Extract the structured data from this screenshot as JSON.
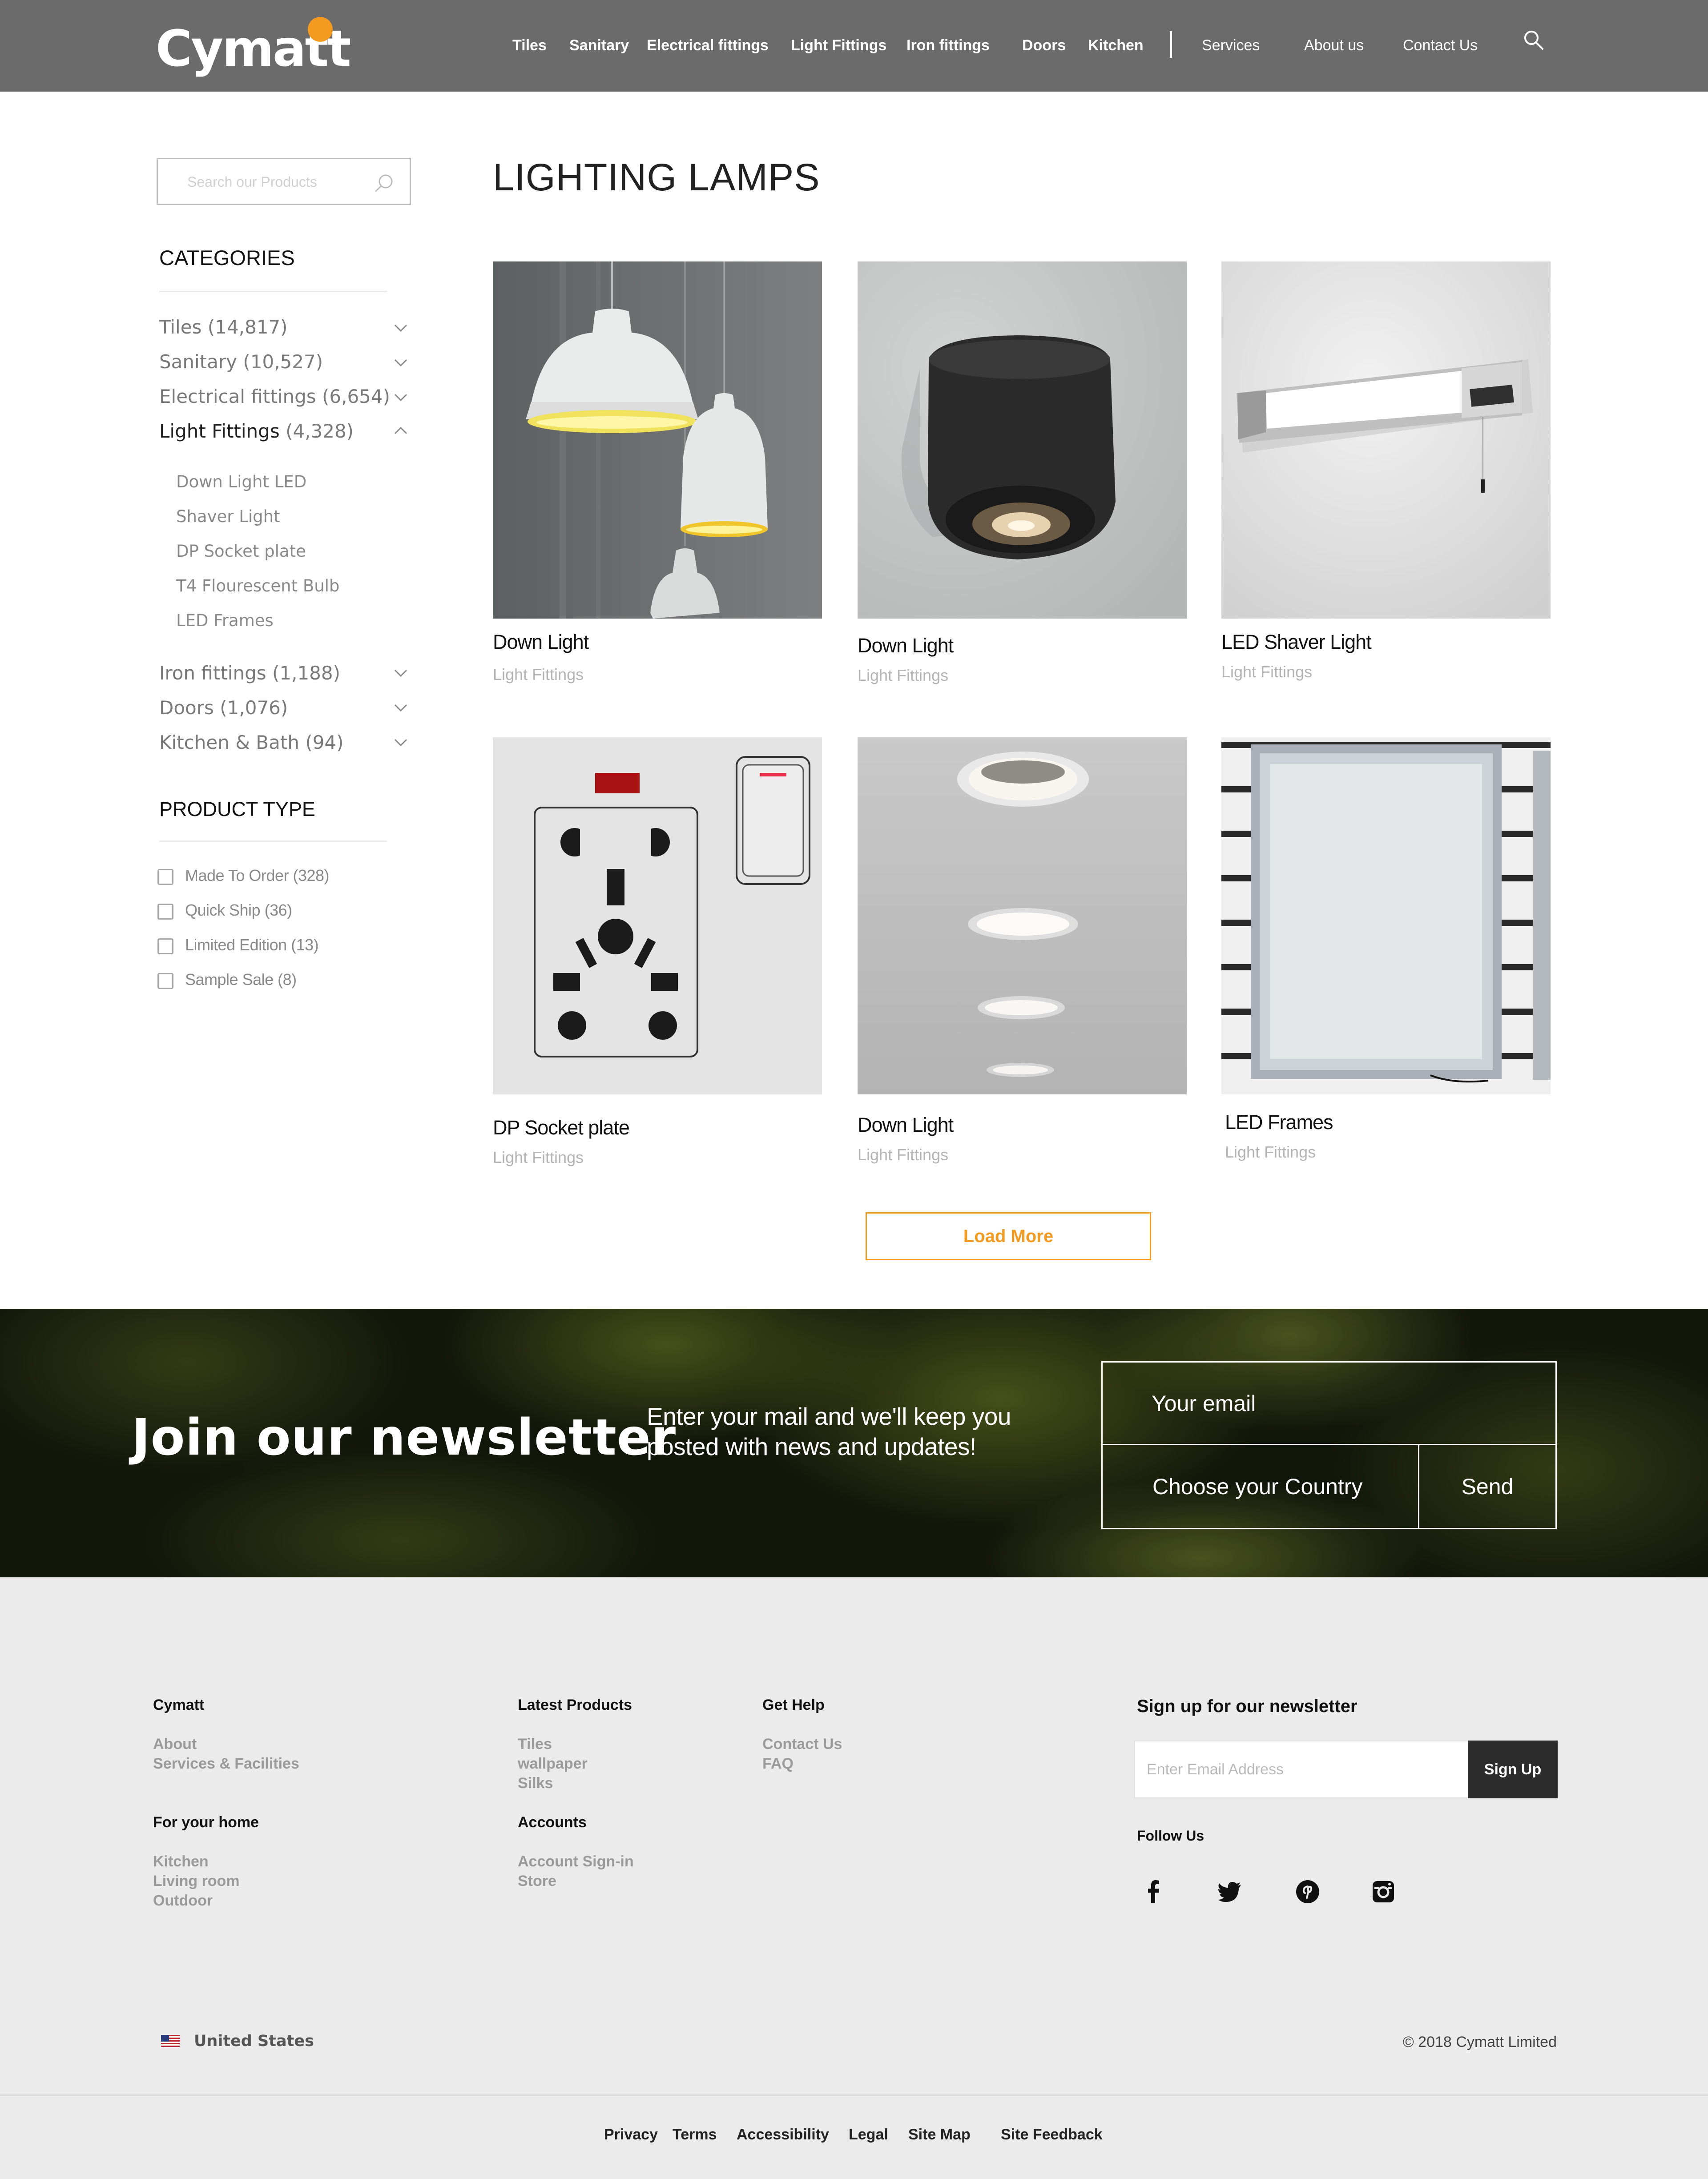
{
  "header": {
    "logo": "Cymatt",
    "nav_primary": [
      "Tiles",
      "Sanitary",
      "Electrical fittings",
      "Light Fittings",
      "Iron fittings",
      "Doors",
      "Kitchen"
    ],
    "nav_secondary": [
      "Services",
      "About us",
      "Contact Us"
    ],
    "search_icon": "search-icon"
  },
  "sidebar": {
    "search_placeholder": "Search our Products",
    "categories_heading": "CATEGORIES",
    "categories": [
      {
        "name": "Tiles",
        "count": "(14,817)",
        "expanded": false
      },
      {
        "name": "Sanitary",
        "count": "(10,527)",
        "expanded": false
      },
      {
        "name": "Electrical fittings",
        "count": "(6,654)",
        "expanded": false
      },
      {
        "name": "Light Fittings",
        "count": "(4,328)",
        "expanded": true
      },
      {
        "name": "Iron fittings",
        "count": "(1,188)",
        "expanded": false
      },
      {
        "name": "Doors",
        "count": "(1,076)",
        "expanded": false
      },
      {
        "name": "Kitchen & Bath",
        "count": "(94)",
        "expanded": false
      }
    ],
    "subcategories": [
      "Down Light LED",
      "Shaver Light",
      "DP Socket plate",
      "T4 Flourescent Bulb",
      "LED Frames"
    ],
    "product_type_heading": "PRODUCT TYPE",
    "product_types": [
      "Made To Order (328)",
      "Quick Ship (36)",
      "Limited Edition (13)",
      "Sample Sale (8)"
    ]
  },
  "main": {
    "title": "LIGHTING LAMPS",
    "products": [
      {
        "title": "Down Light",
        "category": "Light Fittings"
      },
      {
        "title": "Down Light",
        "category": "Light Fittings"
      },
      {
        "title": "LED Shaver Light",
        "category": "Light Fittings"
      },
      {
        "title": "DP Socket plate",
        "category": "Light Fittings"
      },
      {
        "title": "Down Light",
        "category": "Light Fittings"
      },
      {
        "title": "LED Frames",
        "category": "Light Fittings"
      }
    ],
    "load_more": "Load More"
  },
  "newsletter": {
    "title": "Join our newsletter",
    "text": "Enter your mail and we'll keep you posted with news and updates!",
    "email_placeholder": "Your email",
    "country_placeholder": "Choose your Country",
    "send": "Send"
  },
  "footer": {
    "col_cymatt": {
      "heading": "Cymatt",
      "links": [
        "About",
        "Services & Facilities"
      ]
    },
    "col_home": {
      "heading": "For your home",
      "links": [
        "Kitchen",
        "Living room",
        "Outdoor"
      ]
    },
    "col_latest": {
      "heading": "Latest Products",
      "links": [
        "Tiles",
        "wallpaper",
        "Silks"
      ]
    },
    "col_accounts": {
      "heading": "Accounts",
      "links": [
        "Account Sign-in",
        "Store"
      ]
    },
    "col_help": {
      "heading": "Get Help",
      "links": [
        "Contact Us",
        "FAQ"
      ]
    },
    "signup_heading": "Sign up for our newsletter",
    "signup_placeholder": "Enter Email Address",
    "signup_button": "Sign Up",
    "follow_us": "Follow Us",
    "social_icons": [
      "facebook-icon",
      "twitter-icon",
      "pinterest-icon",
      "instagram-icon"
    ],
    "country": "United States",
    "copyright": "© 2018 Cymatt Limited",
    "bottom_links": [
      "Privacy",
      "Terms",
      "Accessibility",
      "Legal",
      "Site Map",
      "Site Feedback"
    ]
  },
  "colors": {
    "header_bg": "#6b6b6b",
    "accent": "#f39a1f",
    "footer_bg": "#ebebeb",
    "dark_button": "#2c2c2c"
  }
}
